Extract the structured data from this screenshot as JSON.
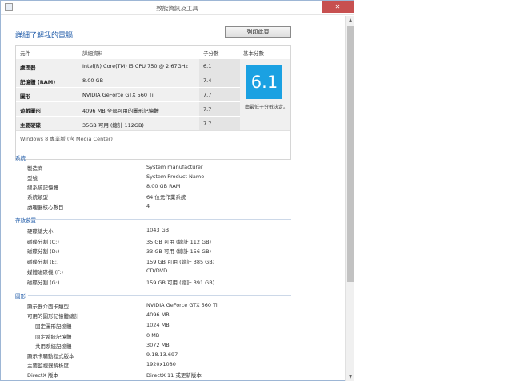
{
  "window": {
    "title": "效能資訊及工具",
    "minimize": "—",
    "maximize": "□",
    "close": "✕"
  },
  "page": {
    "heading": "詳細了解我的電腦",
    "print_label": "列印此頁"
  },
  "score_table": {
    "headers": {
      "component": "元件",
      "detail": "詳細資料",
      "subscore": "子分數",
      "base": "基本分數"
    },
    "rows": [
      {
        "component": "處理器",
        "detail": "Intel(R) Core(TM) i5 CPU 750 @ 2.67GHz",
        "subscore": "6.1"
      },
      {
        "component": "記憶體 (RAM)",
        "detail": "8.00 GB",
        "subscore": "7.4"
      },
      {
        "component": "圖形",
        "detail": "NVIDIA GeForce GTX 560 Ti",
        "subscore": "7.7"
      },
      {
        "component": "遊戲圖形",
        "detail": "4096 MB 全部可用的圖形記憶體",
        "subscore": "7.7"
      },
      {
        "component": "主要硬碟",
        "detail": "35GB 可用 (總計 112GB)",
        "subscore": "7.7"
      }
    ],
    "base_score": "6.1",
    "base_note": "由最低子分數決定。",
    "edition": "Windows 8 專業版 (含 Media Center)"
  },
  "system": {
    "title": "系統",
    "items": [
      {
        "key": "製造商",
        "value": "System manufacturer"
      },
      {
        "key": "型號",
        "value": "System Product Name"
      },
      {
        "key": "總系統記憶體",
        "value": "8.00 GB RAM"
      },
      {
        "key": "系統類型",
        "value": "64 位元作業系統"
      },
      {
        "key": "處理器核心數目",
        "value": "4"
      }
    ]
  },
  "storage": {
    "title": "存放裝置",
    "items": [
      {
        "key": "硬碟總大小",
        "value": "1043 GB"
      },
      {
        "key": "磁碟分割 (C:)",
        "value": "35 GB 可用 (總計 112 GB)"
      },
      {
        "key": "磁碟分割 (D:)",
        "value": "33 GB 可用 (總計 156 GB)"
      },
      {
        "key": "磁碟分割 (E:)",
        "value": "159 GB 可用 (總計 385 GB)"
      },
      {
        "key": "媒體磁碟機 (F:)",
        "value": "CD/DVD"
      },
      {
        "key": "磁碟分割 (G:)",
        "value": "159 GB 可用 (總計 391 GB)"
      }
    ]
  },
  "graphics": {
    "title": "圖形",
    "items": [
      {
        "key": "顯示器介面卡類型",
        "value": "NVIDIA GeForce GTX 560 Ti"
      },
      {
        "key": "可用的圖形記憶體總計",
        "value": "4096 MB"
      },
      {
        "key": "固定圖形記憶體",
        "value": "1024 MB"
      },
      {
        "key": "固定系統記憶體",
        "value": "0 MB"
      },
      {
        "key": "共用系統記憶體",
        "value": "3072 MB"
      },
      {
        "key": "顯示卡驅動程式版本",
        "value": "9.18.13.697"
      },
      {
        "key": "主要監視器解析度",
        "value": "1920x1080"
      },
      {
        "key": "DirectX 版本",
        "value": "DirectX 11 或更新版本"
      }
    ]
  },
  "scrollbar": {
    "up": "▲",
    "down": "▼"
  }
}
